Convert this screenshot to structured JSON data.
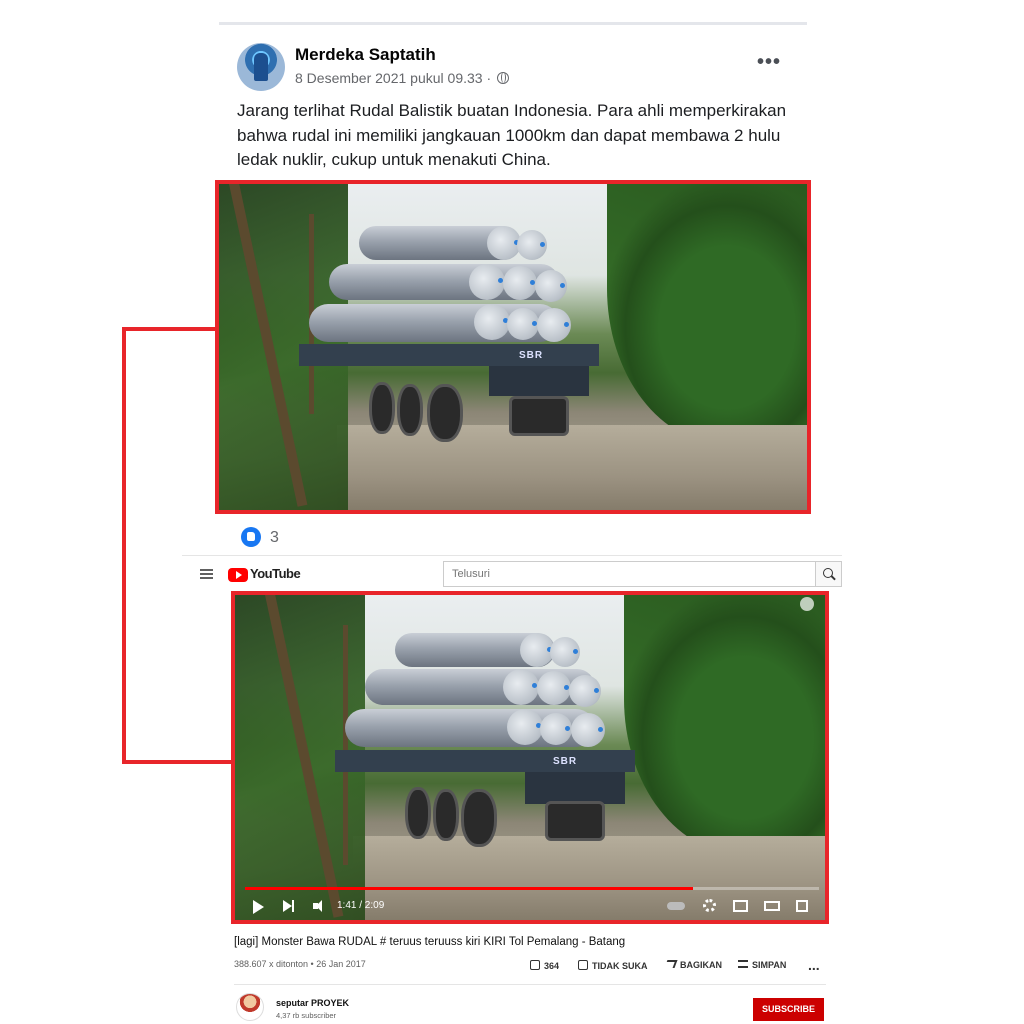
{
  "facebook_post": {
    "author": "Merdeka Saptatih",
    "date": "8 Desember 2021 pukul 09.33 ·",
    "more_label": "•••",
    "text": "Jarang terlihat Rudal Balistik buatan Indonesia. Para ahli memperkirakan bahwa rudal ini memiliki jangkauan 1000km dan dapat membawa 2 hulu ledak nuklir, cukup untuk menakuti China.",
    "truck_label": "SBR",
    "reactions_count": "3",
    "icons": [
      "avatar",
      "globe-icon",
      "more-options-icon",
      "like-icon"
    ]
  },
  "youtube": {
    "logo_text": "YouTube",
    "search_placeholder": "Telusuri",
    "truck_label": "SBR",
    "player": {
      "time": "1:41 / 2:09",
      "progress": 0.78
    },
    "video_title": "[lagi] Monster Bawa RUDAL # teruus teruuss kiri KIRI Tol Pemalang - Batang",
    "meta": "388.607 x ditonton • 26 Jan 2017",
    "actions": {
      "like_count": "364",
      "dislike_label": "TIDAK SUKA",
      "share_label": "BAGIKAN",
      "save_label": "SIMPAN",
      "more_label": "..."
    },
    "channel": {
      "name": "seputar PROYEK",
      "subscribers": "4,37 rb subscriber",
      "subscribe_label": "SUBSCRIBE"
    }
  },
  "colors": {
    "highlight": "#e8252a",
    "facebook_blue": "#1877f2",
    "youtube_red": "#ff0000",
    "subscribe_red": "#cc0000"
  }
}
